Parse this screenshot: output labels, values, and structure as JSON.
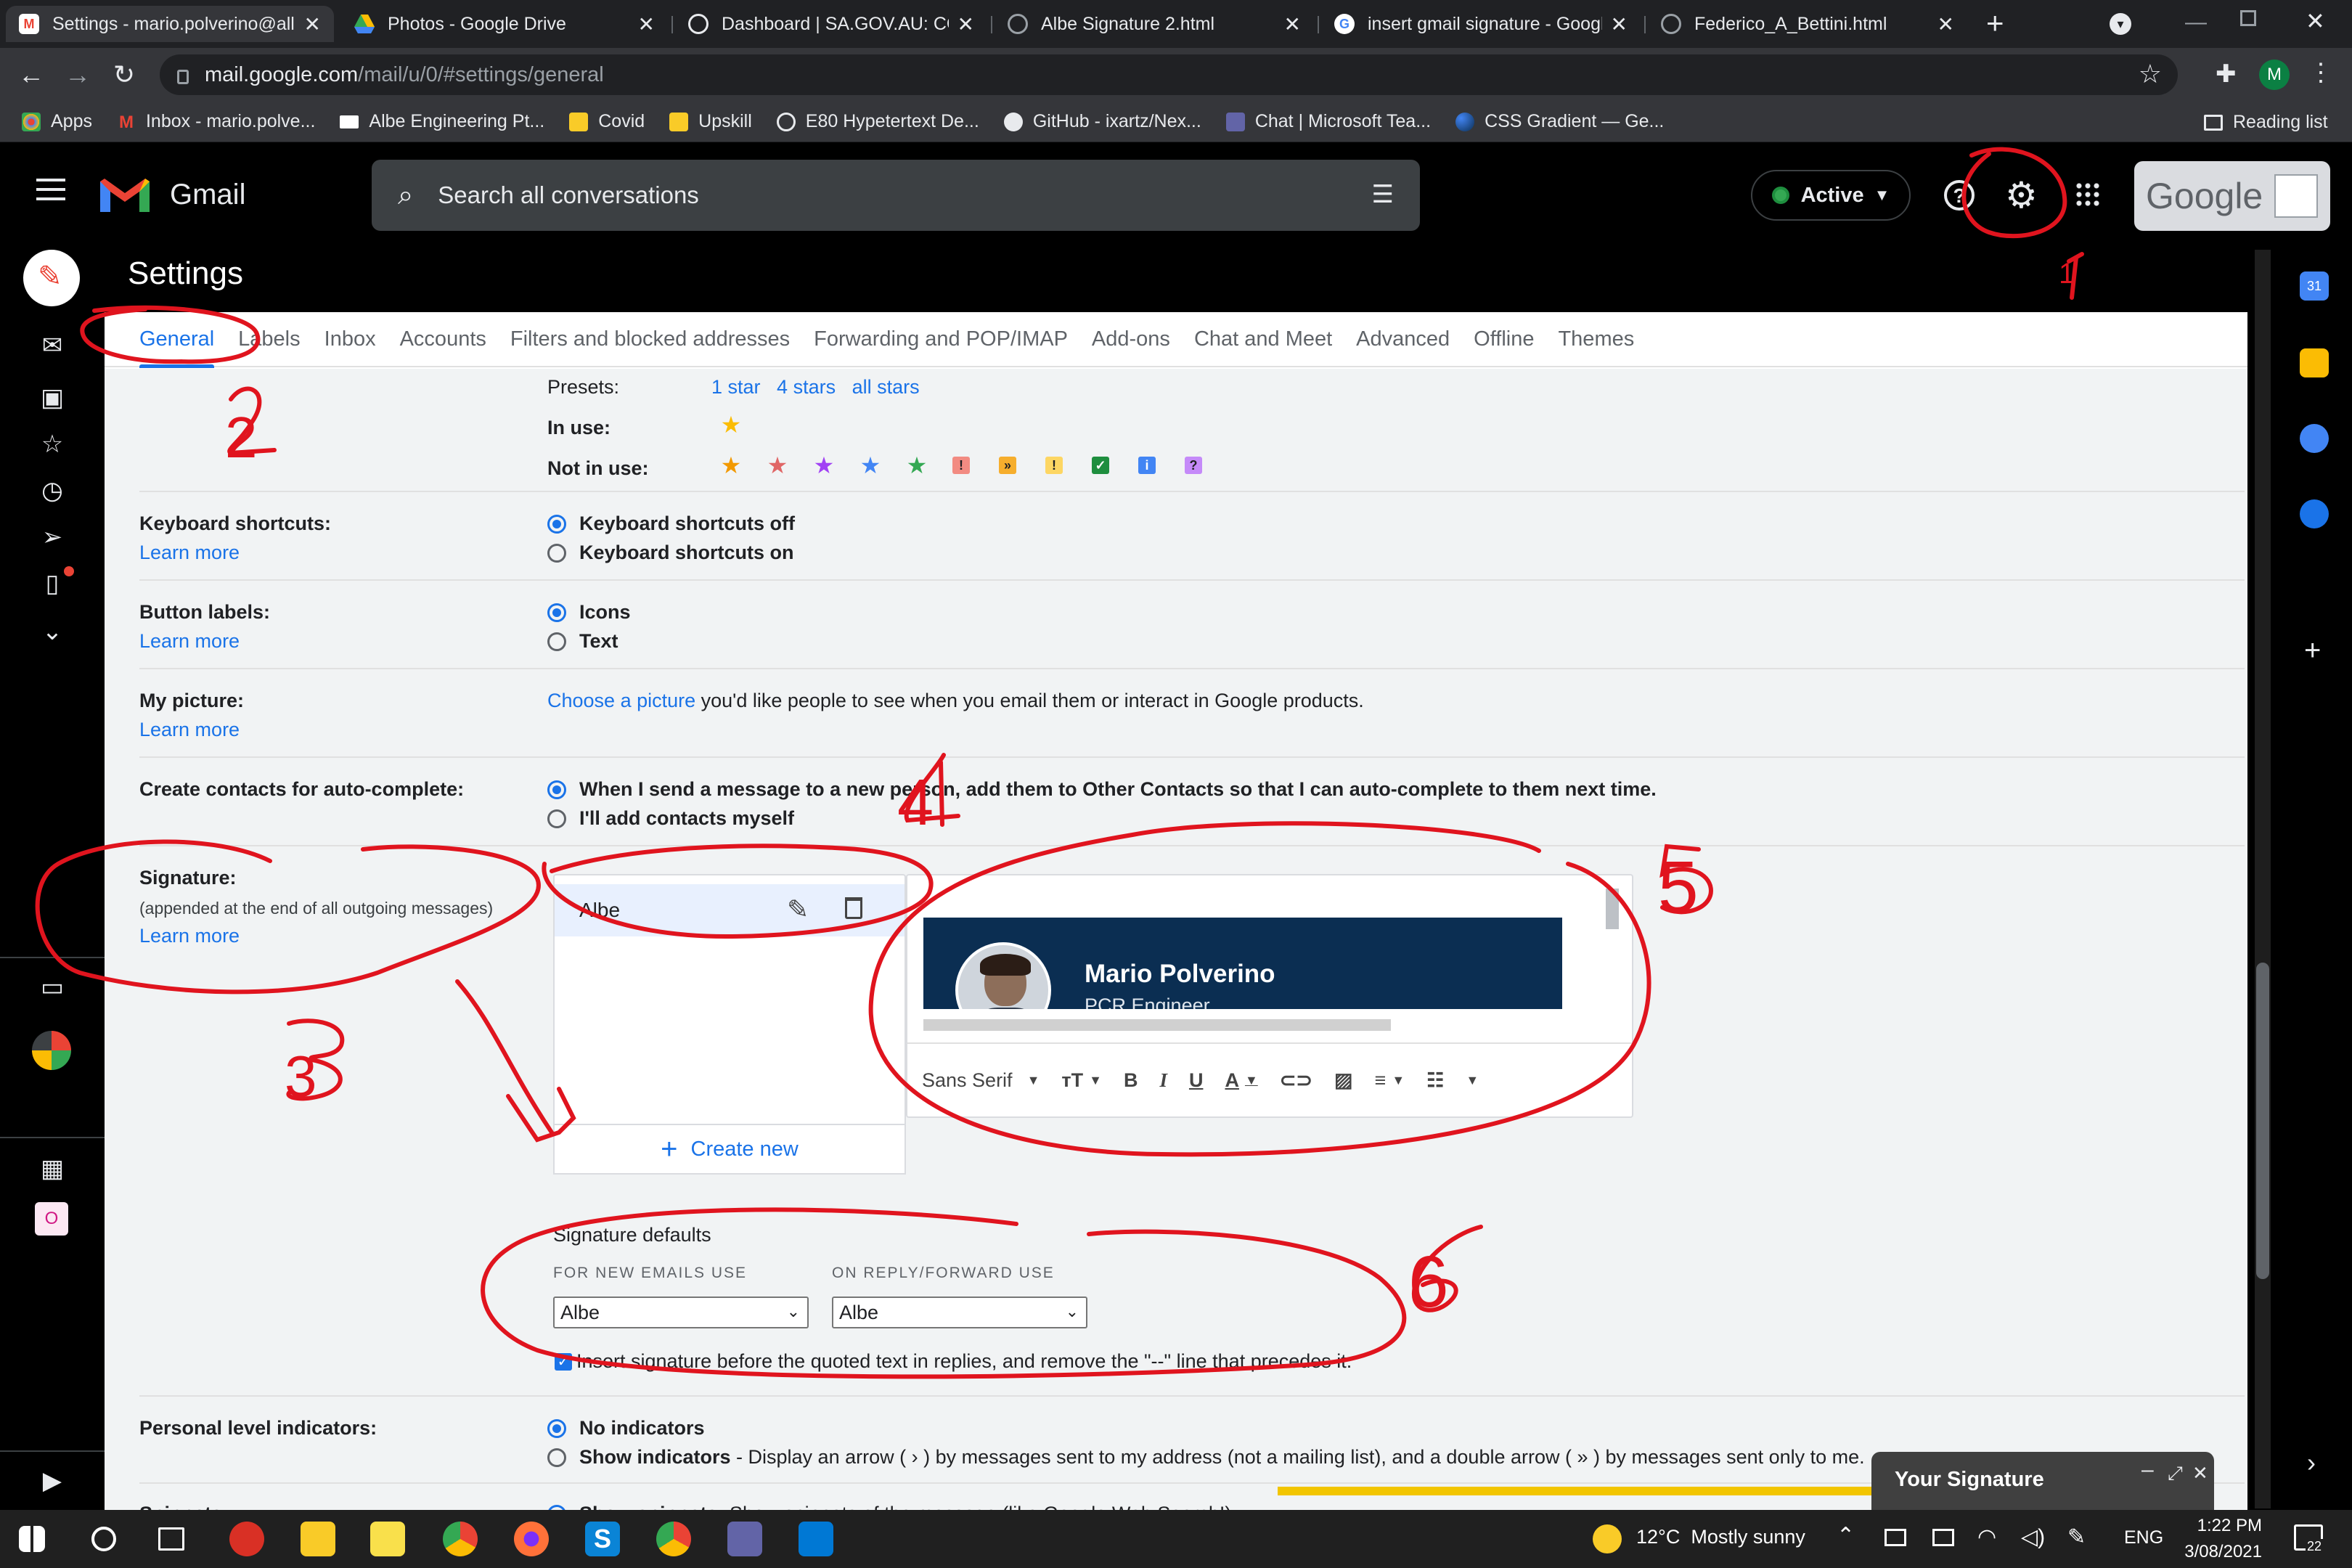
{
  "browser": {
    "tabs": [
      {
        "title": "Settings - mario.polverino@all",
        "icon": "gmail-icon",
        "active": true
      },
      {
        "title": "Photos - Google Drive",
        "icon": "google-drive-icon"
      },
      {
        "title": "Dashboard | SA.GOV.AU: COVI",
        "icon": "globe-icon"
      },
      {
        "title": "Albe Signature 2.html",
        "icon": "globe-icon"
      },
      {
        "title": "insert gmail signature - Googl",
        "icon": "google-icon"
      },
      {
        "title": "Federico_A_Bettini.html",
        "icon": "globe-icon"
      }
    ],
    "new_tab": "+",
    "url_host": "mail.google.com",
    "url_path": "/mail/u/0/#settings/general",
    "profile_initial": "M",
    "bookmarks": [
      {
        "label": "Apps",
        "icon": "apps-grid-icon"
      },
      {
        "label": "Inbox - mario.polve...",
        "icon": "gmail-icon"
      },
      {
        "label": "Albe Engineering Pt...",
        "icon": "albe-icon"
      },
      {
        "label": "Covid",
        "icon": "folder-icon"
      },
      {
        "label": "Upskill",
        "icon": "folder-icon"
      },
      {
        "label": "E80 Hypetertext De...",
        "icon": "globe-icon"
      },
      {
        "label": "GitHub - ixartz/Nex...",
        "icon": "github-icon"
      },
      {
        "label": "Chat | Microsoft Tea...",
        "icon": "teams-icon"
      },
      {
        "label": "CSS Gradient — Ge...",
        "icon": "globe-icon"
      }
    ],
    "reading_list": "Reading list"
  },
  "gmail": {
    "logo_text": "Gmail",
    "search_placeholder": "Search all conversations",
    "status": "Active",
    "google_text": "Google",
    "settings_title": "Settings"
  },
  "settings": {
    "tabs": [
      "General",
      "Labels",
      "Inbox",
      "Accounts",
      "Filters and blocked addresses",
      "Forwarding and POP/IMAP",
      "Add-ons",
      "Chat and Meet",
      "Advanced",
      "Offline",
      "Themes"
    ],
    "stars": {
      "presets_label": "Presets:",
      "presets": [
        "1 star",
        "4 stars",
        "all stars"
      ],
      "in_use_label": "In use:",
      "not_in_use_label": "Not in use:"
    },
    "learn_more": "Learn more",
    "keyboard": {
      "label": "Keyboard shortcuts:",
      "options": [
        "Keyboard shortcuts off",
        "Keyboard shortcuts on"
      ],
      "selected": 0
    },
    "button_labels": {
      "label": "Button labels:",
      "options": [
        "Icons",
        "Text"
      ],
      "selected": 0
    },
    "picture": {
      "label": "My picture:",
      "link": "Choose a picture",
      "text": " you'd like people to see when you email them or interact in Google products."
    },
    "contacts": {
      "label": "Create contacts for auto-complete:",
      "options": [
        "When I send a message to a new person, add them to Other Contacts so that I can auto-complete to them next time.",
        "I'll add contacts myself"
      ],
      "selected": 0
    },
    "signature": {
      "label": "Signature:",
      "sublabel": "(appended at the end of all outgoing messages)",
      "item": "Albe",
      "create_new": "Create new",
      "preview_name": "Mario Polverino",
      "preview_role": "PCR Engineer",
      "font": "Sans Serif",
      "defaults_title": "Signature defaults",
      "new_emails_label": "FOR NEW EMAILS USE",
      "reply_label": "ON REPLY/FORWARD USE",
      "new_emails_value": "Albe",
      "reply_value": "Albe",
      "insert_before": "Insert signature before the quoted text in replies, and remove the \"--\" line that precedes it.",
      "insert_checked": true
    },
    "personal": {
      "label": "Personal level indicators:",
      "options": [
        "No indicators",
        "Show indicators"
      ],
      "show_desc": " - Display an arrow ( › ) by messages sent to my address (not a mailing list), and a double arrow ( » ) by messages sent only to me.",
      "selected": 0
    },
    "snippets": {
      "label": "Snippets:",
      "option": "Show snippets",
      "desc": " - Show snippets of the message (like Google Web Search!)."
    }
  },
  "chat_window": {
    "title": "Your Signature"
  },
  "taskbar": {
    "weather": "12°C  Mostly sunny",
    "lang": "ENG",
    "time": "1:22 PM",
    "date": "3/08/2021",
    "notif_count": "22"
  },
  "annotations": [
    "1",
    "2",
    "3",
    "4",
    "5",
    "6"
  ],
  "colors": {
    "accent": "#1a73e8",
    "annotation": "#e0141e",
    "banner": "#0b2e52"
  }
}
